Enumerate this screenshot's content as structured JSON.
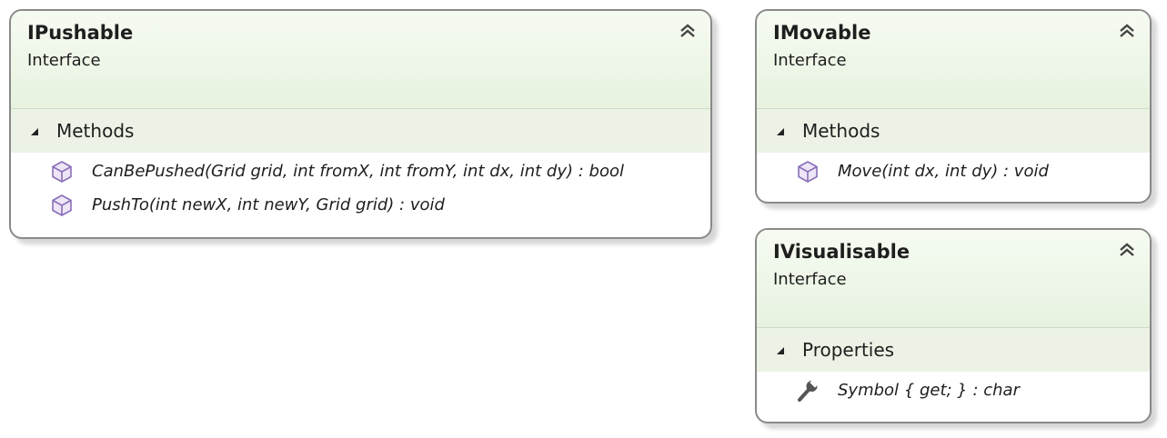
{
  "shapes": {
    "ipushable": {
      "title": "IPushable",
      "stereotype": "Interface",
      "section_label": "Methods",
      "members": [
        {
          "icon": "method-cube-icon",
          "text": "CanBePushed(Grid grid, int fromX, int fromY, int dx, int dy) : bool"
        },
        {
          "icon": "method-cube-icon",
          "text": "PushTo(int newX, int newY, Grid grid) : void"
        }
      ]
    },
    "imovable": {
      "title": "IMovable",
      "stereotype": "Interface",
      "section_label": "Methods",
      "members": [
        {
          "icon": "method-cube-icon",
          "text": "Move(int dx, int dy) : void"
        }
      ]
    },
    "ivisualisable": {
      "title": "IVisualisable",
      "stereotype": "Interface",
      "section_label": "Properties",
      "members": [
        {
          "icon": "wrench-icon",
          "text": "Symbol { get; } : char"
        }
      ]
    }
  },
  "colors": {
    "header_gradient_top": "#f6fbf2",
    "header_gradient_bottom": "#e7f2df",
    "section_band": "#ecf3e6",
    "border": "#8a8a8a",
    "method_icon": "#8a6fb8"
  }
}
